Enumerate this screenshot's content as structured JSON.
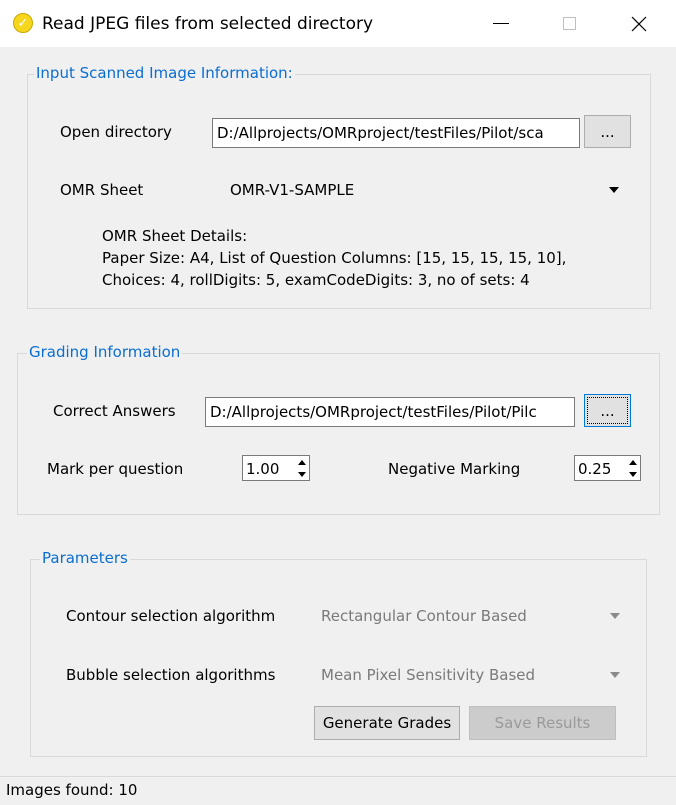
{
  "window": {
    "title": "Read JPEG files from selected directory",
    "icon": "check-circle-icon",
    "controls": {
      "minimize": "minimize-icon",
      "maximize": "maximize-icon",
      "close": "close-icon"
    }
  },
  "input_group": {
    "title": "Input Scanned Image Information:",
    "open_directory_label": "Open directory",
    "open_directory_value": "D:/Allprojects/OMRproject/testFiles/Pilot/sca",
    "browse_label": "...",
    "omr_sheet_label": "OMR Sheet",
    "omr_sheet_value": "OMR-V1-SAMPLE",
    "details_heading": "OMR Sheet Details:",
    "details_line1": "Paper Size: A4, List of Question Columns: [15, 15, 15, 15, 10],",
    "details_line2": "Choices: 4, rollDigits: 5, examCodeDigits: 3, no of sets: 4"
  },
  "grading_group": {
    "title": "Grading Information",
    "correct_answers_label": "Correct Answers",
    "correct_answers_value": "D:/Allprojects/OMRproject/testFiles/Pilot/Pilc",
    "browse_label": "...",
    "mark_label": "Mark per question",
    "mark_value": "1.00",
    "negative_label": "Negative Marking",
    "negative_value": "0.25"
  },
  "parameters_group": {
    "title": "Parameters",
    "contour_label": "Contour selection algorithm",
    "contour_value": "Rectangular Contour Based",
    "bubble_label": "Bubble selection algorithms",
    "bubble_value": "Mean Pixel Sensitivity Based",
    "generate_label": "Generate Grades",
    "save_label": "Save Results"
  },
  "status": {
    "text": "Images found: 10"
  },
  "colors": {
    "accent": "#0a6ed1",
    "disabled_text": "#7a7a7a"
  }
}
